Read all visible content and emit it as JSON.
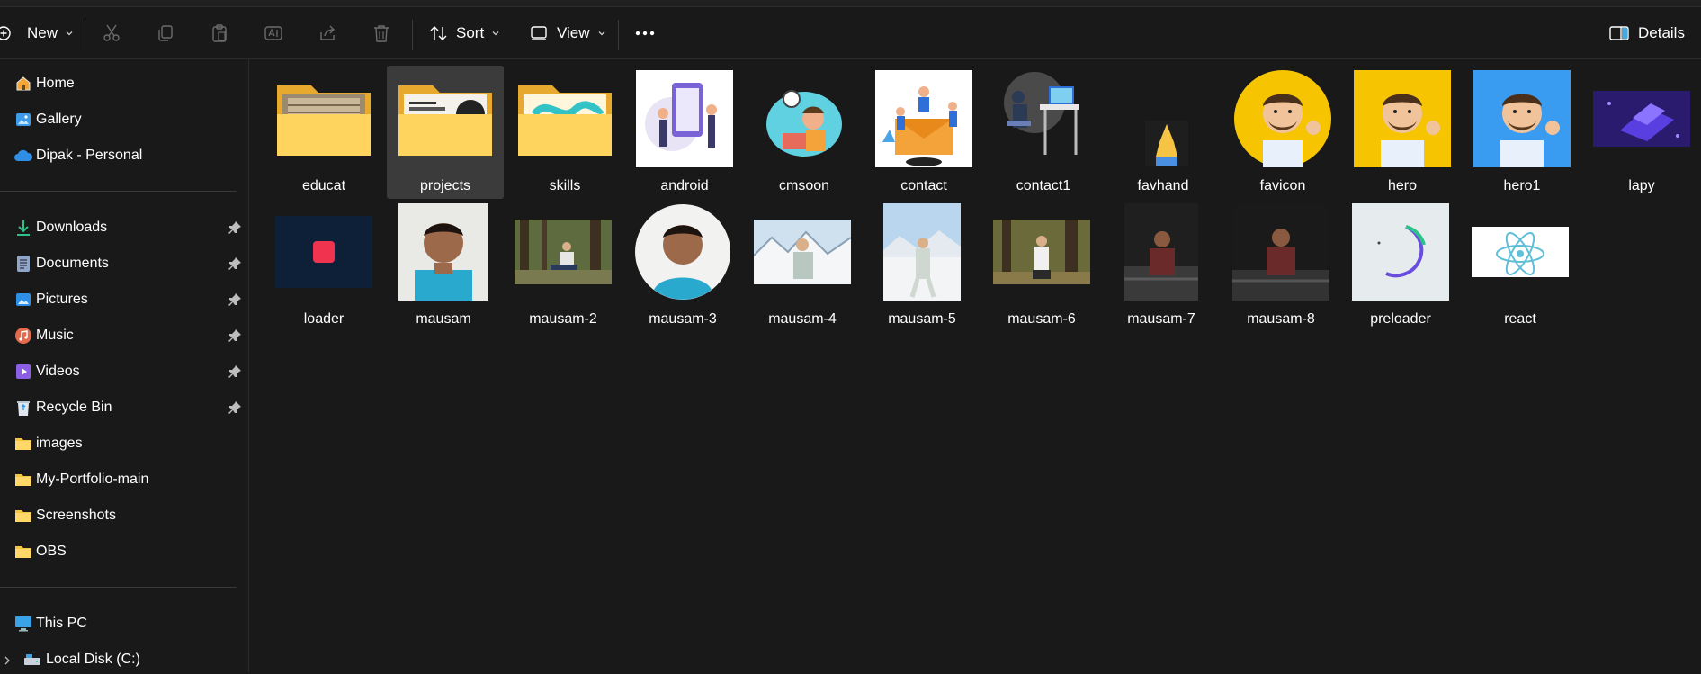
{
  "toolbar": {
    "new_label": "New",
    "sort_label": "Sort",
    "view_label": "View",
    "details_label": "Details"
  },
  "sidebar": {
    "top_items": [
      {
        "label": "Home",
        "icon": "home-icon"
      },
      {
        "label": "Gallery",
        "icon": "gallery-icon"
      },
      {
        "label": "Dipak - Personal",
        "icon": "onedrive-cloud-icon"
      }
    ],
    "quick_access": [
      {
        "label": "Downloads",
        "icon": "download-icon",
        "pinned": true
      },
      {
        "label": "Documents",
        "icon": "documents-icon",
        "pinned": true
      },
      {
        "label": "Pictures",
        "icon": "pictures-icon",
        "pinned": true
      },
      {
        "label": "Music",
        "icon": "music-icon",
        "pinned": true
      },
      {
        "label": "Videos",
        "icon": "videos-icon",
        "pinned": true
      },
      {
        "label": "Recycle Bin",
        "icon": "recycle-bin-icon",
        "pinned": true
      },
      {
        "label": "images",
        "icon": "folder-icon",
        "pinned": false
      },
      {
        "label": "My-Portfolio-main",
        "icon": "folder-icon",
        "pinned": false
      },
      {
        "label": "Screenshots",
        "icon": "folder-icon",
        "pinned": false
      },
      {
        "label": "OBS",
        "icon": "folder-icon",
        "pinned": false
      }
    ],
    "this_pc": {
      "label": "This PC",
      "icon": "computer-icon"
    },
    "local_disk": {
      "label": "Local Disk (C:)",
      "icon": "drive-icon"
    }
  },
  "files": [
    {
      "name": "educat",
      "kind": "folder"
    },
    {
      "name": "projects",
      "kind": "folder",
      "selected": true
    },
    {
      "name": "skills",
      "kind": "folder"
    },
    {
      "name": "android",
      "kind": "image"
    },
    {
      "name": "cmsoon",
      "kind": "image"
    },
    {
      "name": "contact",
      "kind": "image"
    },
    {
      "name": "contact1",
      "kind": "image"
    },
    {
      "name": "favhand",
      "kind": "image"
    },
    {
      "name": "favicon",
      "kind": "image"
    },
    {
      "name": "hero",
      "kind": "image"
    },
    {
      "name": "hero1",
      "kind": "image"
    },
    {
      "name": "lapy",
      "kind": "image"
    },
    {
      "name": "loader",
      "kind": "image"
    },
    {
      "name": "mausam",
      "kind": "image"
    },
    {
      "name": "mausam-2",
      "kind": "image"
    },
    {
      "name": "mausam-3",
      "kind": "image"
    },
    {
      "name": "mausam-4",
      "kind": "image"
    },
    {
      "name": "mausam-5",
      "kind": "image"
    },
    {
      "name": "mausam-6",
      "kind": "image"
    },
    {
      "name": "mausam-7",
      "kind": "image"
    },
    {
      "name": "mausam-8",
      "kind": "image"
    },
    {
      "name": "preloader",
      "kind": "image"
    },
    {
      "name": "react",
      "kind": "image"
    }
  ],
  "colors": {
    "background": "#191919",
    "folder_yellow": "#f6c445",
    "accent_blue": "#4cc2ff"
  }
}
